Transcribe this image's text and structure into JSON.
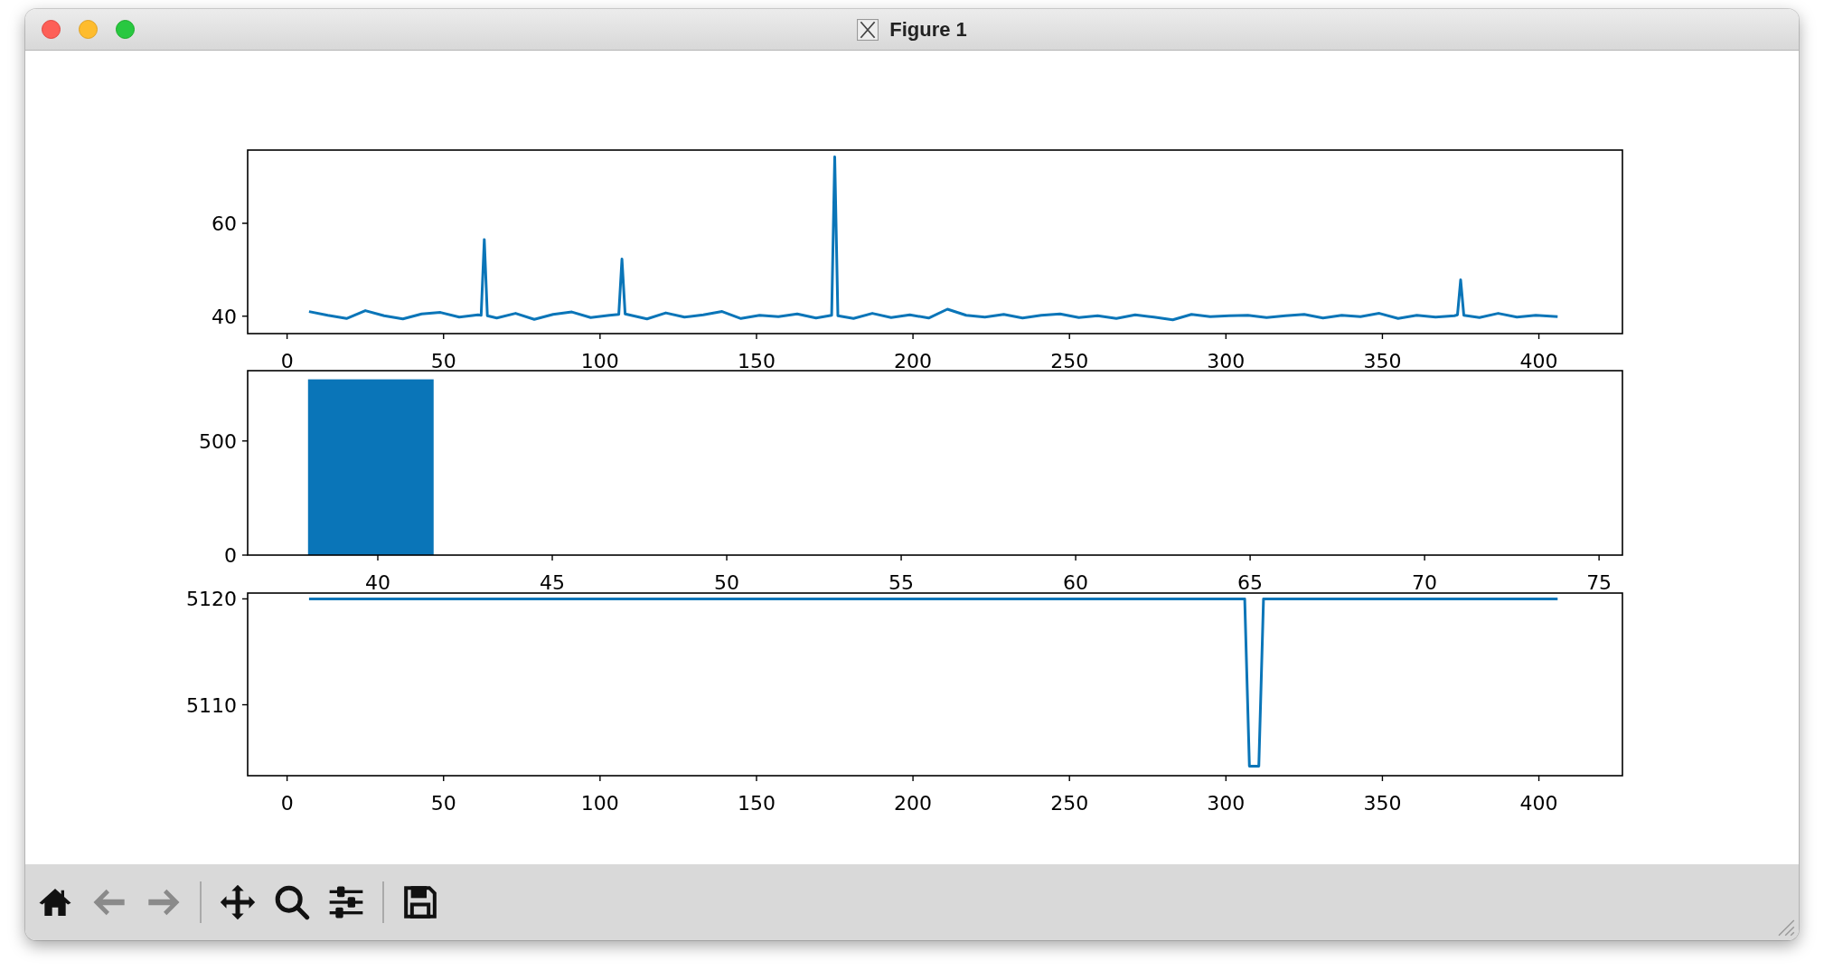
{
  "window": {
    "title": "Figure 1"
  },
  "subplots": [
    {
      "chart_data": {
        "type": "line",
        "xlim": [
          -12.6,
          426.7
        ],
        "ylim": [
          36.25,
          75.75
        ],
        "xticks": [
          0,
          50,
          100,
          150,
          200,
          250,
          300,
          350,
          400
        ],
        "yticks": [
          40,
          60
        ],
        "x": [
          7,
          13,
          19,
          25,
          31,
          37,
          43,
          49,
          55,
          61,
          62,
          63,
          64,
          67,
          73,
          79,
          85,
          91,
          97,
          103,
          106,
          107,
          108,
          115,
          121,
          127,
          133,
          139,
          145,
          151,
          157,
          163,
          169,
          174,
          175,
          176,
          181,
          187,
          193,
          199,
          205,
          211,
          217,
          223,
          229,
          235,
          241,
          247,
          253,
          259,
          265,
          271,
          277,
          283,
          289,
          295,
          301,
          307,
          313,
          319,
          325,
          331,
          337,
          343,
          349,
          355,
          361,
          367,
          373,
          374,
          375,
          376,
          381,
          387,
          393,
          399,
          406
        ],
        "values": [
          41,
          40.2,
          39.5,
          41.2,
          40.1,
          39.4,
          40.5,
          40.8,
          39.8,
          40.3,
          40.2,
          56.5,
          40.1,
          39.6,
          40.6,
          39.3,
          40.4,
          40.9,
          39.7,
          40.2,
          40.4,
          52.3,
          40.5,
          39.4,
          40.7,
          39.8,
          40.3,
          41,
          39.5,
          40.2,
          39.9,
          40.5,
          39.6,
          40.2,
          74.3,
          40.1,
          39.5,
          40.6,
          39.7,
          40.3,
          39.6,
          41.5,
          40.2,
          39.8,
          40.4,
          39.6,
          40.2,
          40.5,
          39.7,
          40.1,
          39.5,
          40.3,
          39.8,
          39.2,
          40.4,
          39.9,
          40.1,
          40.2,
          39.7,
          40.1,
          40.4,
          39.6,
          40.2,
          39.9,
          40.6,
          39.5,
          40.2,
          39.8,
          40.1,
          40.3,
          47.8,
          40.2,
          39.7,
          40.6,
          39.8,
          40.2,
          39.9
        ]
      }
    },
    {
      "chart_data": {
        "type": "bar",
        "xlim": [
          36.27,
          75.67
        ],
        "ylim": [
          0,
          808
        ],
        "xticks": [
          40,
          45,
          50,
          55,
          60,
          65,
          70,
          75
        ],
        "yticks": [
          0,
          500
        ],
        "x": [
          39.8,
          43.4,
          47,
          50.6,
          54.2,
          57.8,
          61.4,
          65,
          68.6,
          72.2
        ],
        "values": [
          770,
          0,
          0,
          0,
          0,
          0,
          0,
          0,
          0,
          0
        ]
      }
    },
    {
      "chart_data": {
        "type": "line",
        "xlim": [
          -12.6,
          426.7
        ],
        "ylim": [
          5103.3,
          5120.55
        ],
        "xticks": [
          0,
          50,
          100,
          150,
          200,
          250,
          300,
          350,
          400
        ],
        "yticks": [
          5110,
          5120
        ],
        "x": [
          7,
          306,
          307.5,
          310.5,
          312,
          406
        ],
        "values": [
          5120,
          5120,
          5104.2,
          5104.2,
          5120,
          5120
        ]
      }
    }
  ],
  "toolbar": [
    {
      "kind": "home",
      "disabled": false
    },
    {
      "kind": "back",
      "disabled": true
    },
    {
      "kind": "forward",
      "disabled": true
    },
    {
      "kind": "separator"
    },
    {
      "kind": "pan",
      "disabled": false
    },
    {
      "kind": "zoom",
      "disabled": false
    },
    {
      "kind": "configure",
      "disabled": false
    },
    {
      "kind": "separator"
    },
    {
      "kind": "save",
      "disabled": false
    }
  ]
}
